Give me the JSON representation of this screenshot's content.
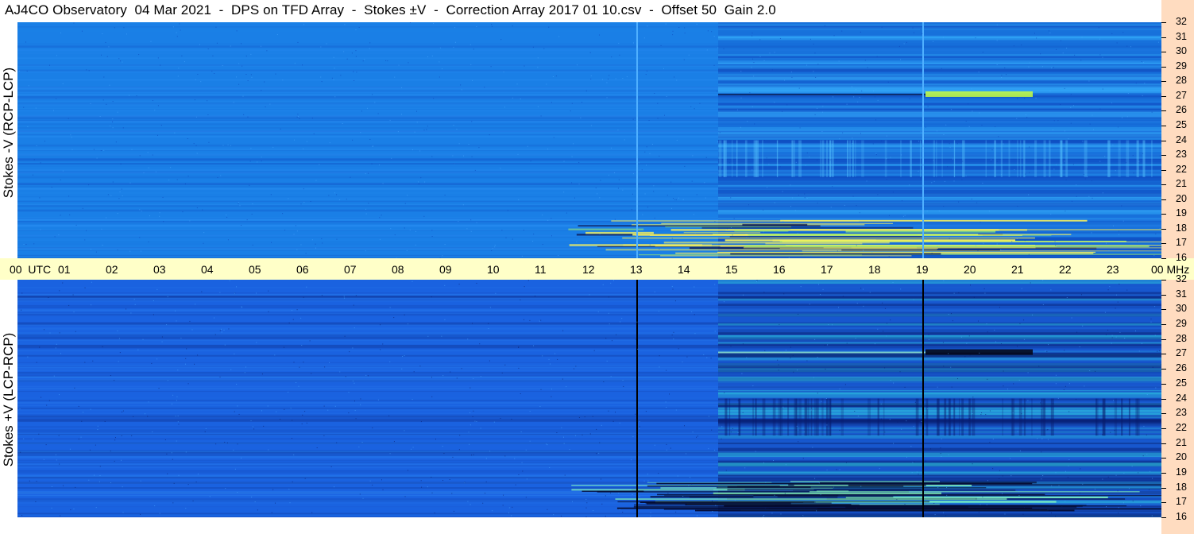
{
  "title": "AJ4CO Observatory  04 Mar 2021  -  DPS on TFD Array  -  Stokes ±V  -  Correction Array 2017 01 10.csv  -  Offset 50  Gain 2.0",
  "chart_data": [
    {
      "type": "heatmap",
      "panel": "top",
      "ylabel": "Stokes -V (RCP-LCP)",
      "x_unit": "UTC",
      "y_unit": "MHz",
      "xlim": [
        0,
        24
      ],
      "ylim": [
        16,
        32
      ],
      "colormap": "blue-cyan-yellow",
      "colors": {
        "base": "#1a7fe6",
        "dark": "#0c3fb8",
        "bright": "#8ff05a"
      },
      "vertical_lines_utc": [
        13.0,
        19.0
      ],
      "vertical_line_color": "#4fb0ff"
    },
    {
      "type": "heatmap",
      "panel": "bottom",
      "ylabel": "Stokes +V (LCP-RCP)",
      "x_unit": "UTC",
      "y_unit": "MHz",
      "xlim": [
        0,
        24
      ],
      "ylim": [
        16,
        32
      ],
      "colormap": "blue-cyan-yellow",
      "colors": {
        "base": "#1a62e0",
        "dark": "#081a6a",
        "bright": "#3fe6c8"
      },
      "vertical_lines_utc": [
        13.0,
        19.0
      ],
      "vertical_line_color": "#000000"
    }
  ],
  "time_axis": {
    "labels": [
      "00  UTC",
      "01",
      "02",
      "03",
      "04",
      "05",
      "06",
      "07",
      "08",
      "09",
      "10",
      "11",
      "12",
      "13",
      "14",
      "15",
      "16",
      "17",
      "18",
      "19",
      "20",
      "21",
      "22",
      "23",
      "00 MHz"
    ]
  },
  "freq_axis": {
    "labels": [
      "32",
      "31",
      "30",
      "29",
      "28",
      "27",
      "26",
      "25",
      "24",
      "23",
      "22",
      "21",
      "20",
      "19",
      "18",
      "17",
      "16"
    ]
  }
}
